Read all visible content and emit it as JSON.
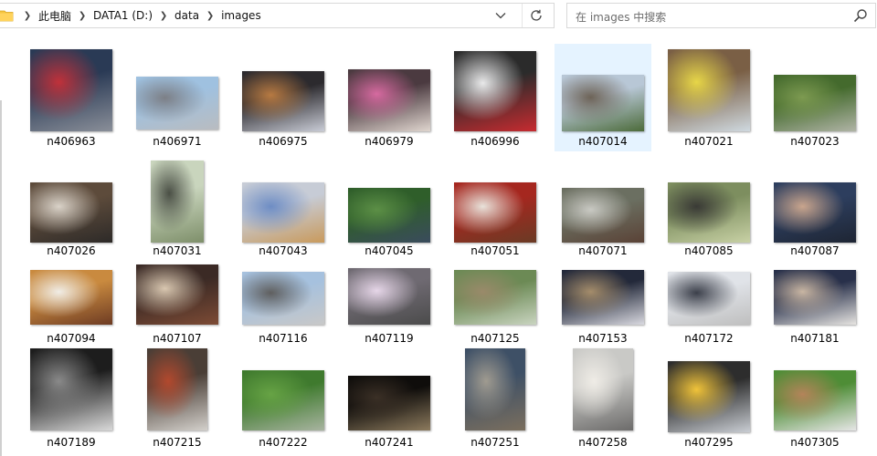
{
  "address_bar": {
    "breadcrumbs": [
      "此电脑",
      "DATA1 (D:)",
      "data",
      "images"
    ]
  },
  "search": {
    "placeholder": "在 images 中搜索"
  },
  "icons": {
    "folder": "folder-icon",
    "separator": "chevron-right-icon",
    "dropdown": "chevron-down-icon",
    "refresh": "refresh-icon",
    "search": "search-icon"
  },
  "colors": {
    "selection": "#e5f3ff",
    "folder": "#f4c542"
  },
  "files": [
    {
      "name": "n406963",
      "selected": false,
      "colors": [
        "#2a3a55",
        "#c0313a",
        "#8a8f99"
      ]
    },
    {
      "name": "n406971",
      "selected": false,
      "colors": [
        "#9fc1e0",
        "#7c7f86",
        "#b9bcc0"
      ]
    },
    {
      "name": "n406975",
      "selected": false,
      "colors": [
        "#2c2a2e",
        "#b77a42",
        "#c9ccd6"
      ]
    },
    {
      "name": "n406979",
      "selected": false,
      "colors": [
        "#4b3a40",
        "#d66aa0",
        "#e0d6cf"
      ]
    },
    {
      "name": "n406996",
      "selected": false,
      "colors": [
        "#2b2b2b",
        "#e9e9ea",
        "#c72b30"
      ]
    },
    {
      "name": "n407014",
      "selected": true,
      "colors": [
        "#b8c7d6",
        "#6d6357",
        "#4c6b3a"
      ]
    },
    {
      "name": "n407021",
      "selected": false,
      "colors": [
        "#7a5f45",
        "#e7d648",
        "#cfd9e0"
      ]
    },
    {
      "name": "n407023",
      "selected": false,
      "colors": [
        "#446a2d",
        "#7d9a51",
        "#b0b4a6"
      ]
    },
    {
      "name": "n407026",
      "selected": false,
      "colors": [
        "#5d4b3b",
        "#d9d2c8",
        "#2d2a28"
      ]
    },
    {
      "name": "n407031",
      "selected": false,
      "colors": [
        "#c9d5bd",
        "#4a4f45",
        "#7e8f6a"
      ]
    },
    {
      "name": "n407043",
      "selected": false,
      "colors": [
        "#c7ccd6",
        "#6e8dc4",
        "#c99a5c"
      ]
    },
    {
      "name": "n407045",
      "selected": false,
      "colors": [
        "#2f5e2a",
        "#5c8f46",
        "#3a4b5d"
      ]
    },
    {
      "name": "n407051",
      "selected": false,
      "colors": [
        "#a5271f",
        "#e8e2da",
        "#6a3b25"
      ]
    },
    {
      "name": "n407071",
      "selected": false,
      "colors": [
        "#6b6f61",
        "#c9c9c3",
        "#5a4236"
      ]
    },
    {
      "name": "n407085",
      "selected": false,
      "colors": [
        "#7d8e5f",
        "#3a3a36",
        "#c8d1a5"
      ]
    },
    {
      "name": "n407087",
      "selected": false,
      "colors": [
        "#2d3e5e",
        "#c9a58d",
        "#1e2533"
      ]
    },
    {
      "name": "n407094",
      "selected": false,
      "colors": [
        "#c98a3f",
        "#f0ede6",
        "#6d3b23"
      ]
    },
    {
      "name": "n407107",
      "selected": false,
      "colors": [
        "#3b2a25",
        "#d9c7b0",
        "#7d4b35"
      ]
    },
    {
      "name": "n407116",
      "selected": false,
      "colors": [
        "#a6c1de",
        "#5f5f5f",
        "#c8c8c8"
      ]
    },
    {
      "name": "n407119",
      "selected": false,
      "colors": [
        "#6f6a72",
        "#e6d6e8",
        "#4b4b4b"
      ]
    },
    {
      "name": "n407125",
      "selected": false,
      "colors": [
        "#6c8a55",
        "#9a8a6a",
        "#c9d4c0"
      ]
    },
    {
      "name": "n407153",
      "selected": false,
      "colors": [
        "#23293a",
        "#a58d6b",
        "#d9d9e0"
      ]
    },
    {
      "name": "n407172",
      "selected": false,
      "colors": [
        "#e0e3e8",
        "#3b3f4a",
        "#bfbfbf"
      ]
    },
    {
      "name": "n407181",
      "selected": false,
      "colors": [
        "#28304a",
        "#c9b6a3",
        "#e6e4e1"
      ]
    },
    {
      "name": "n407189",
      "selected": false,
      "colors": [
        "#1d1d1d",
        "#8a8a8a",
        "#d9d9d9"
      ]
    },
    {
      "name": "n407215",
      "selected": false,
      "colors": [
        "#4a3e36",
        "#b2492e",
        "#d3d0cb"
      ]
    },
    {
      "name": "n407222",
      "selected": false,
      "colors": [
        "#3f7a2e",
        "#67a345",
        "#a8b4a0"
      ]
    },
    {
      "name": "n407241",
      "selected": false,
      "colors": [
        "#0f0d0b",
        "#3b3026",
        "#8c7a5d"
      ]
    },
    {
      "name": "n407251",
      "selected": false,
      "colors": [
        "#3e5066",
        "#a09b90",
        "#7b6f5e"
      ]
    },
    {
      "name": "n407258",
      "selected": false,
      "colors": [
        "#c9c9c6",
        "#efece6",
        "#6c6b6a"
      ]
    },
    {
      "name": "n407295",
      "selected": false,
      "colors": [
        "#2d2d2d",
        "#f0c33a",
        "#c9cdd3"
      ]
    },
    {
      "name": "n407305",
      "selected": false,
      "colors": [
        "#4e8d36",
        "#b4845a",
        "#e6e6e6"
      ]
    }
  ]
}
